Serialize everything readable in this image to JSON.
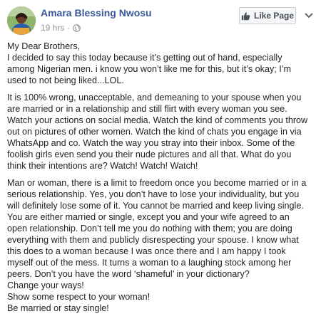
{
  "post": {
    "author": "Amara Blessing Nwosu",
    "time": "19 hrs",
    "separator": "·",
    "privacy_icon": "globe-icon",
    "like_page_label": "Like Page",
    "like_icon": "thumbs-up-icon",
    "more_icon": "chevron-down-icon",
    "paragraphs": [
      {
        "lines": [
          "My Dear Brothers,",
          "I decided to say this today because it’s getting out of hand, especially",
          "among Nigerian men. i know you won’t like me for this, but it’s okay; I’m",
          "used to not being liked...LOL."
        ]
      },
      {
        "lines": [
          "It is 100% wrong, unacceptable, and demeaning to your spouse when you",
          "are married or in a relationship and still flirt with every woman you see.",
          "Watch your actions on social media. Watch the kind of comments you throw",
          "out on pictures of other women. Watch the kind of chats you engage in via",
          "WhatsApp and co. Watch the way you stray into their inbox. Some of the",
          "foolish girls even send you their nude pictures and all that. What do you",
          "think their intentions are? Watch! Watch! Watch!"
        ]
      },
      {
        "lines": [
          "Man or woman, there is a limit to freedom once you become married or in a",
          "serious relationship. Yes, you don’t have to lose your individuality, but you",
          "will definitely lose some of it. You cannot be married and keep living single.",
          "You are either married or single, except you and your wife agreed to an",
          "open relationship. Don’t tell me you do nothing with them; you are doing",
          "everything with them and publicly disrespecting your spouse. I know what",
          "this does to a woman because I was once there and I am happy I took",
          "myself out of the mess. It turns a woman to a laughing stock among her",
          "peers. Don’t you have the word ‘shameful’ in your dictionary?",
          "Change your ways!",
          "Show some respect to your woman!",
          "Be married or stay single!"
        ]
      }
    ]
  },
  "colors": {
    "author_link": "#385898",
    "meta_text": "#90949c",
    "body_text": "#1c1e21",
    "button_bg": "#f5f6f7",
    "button_border": "#ccd0d5"
  }
}
